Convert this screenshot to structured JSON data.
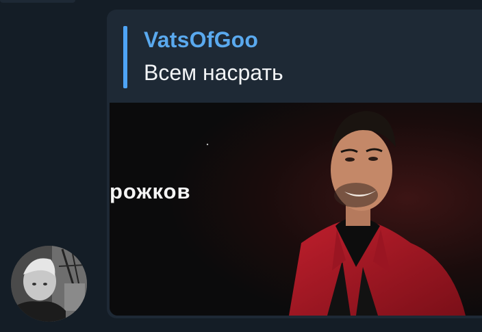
{
  "message": {
    "reply": {
      "author": "VatsOfGoo",
      "text": "Всем насрать"
    },
    "media": {
      "caption": "рожков"
    }
  },
  "colors": {
    "background": "#141d26",
    "bubble": "#1e2935",
    "accent": "#4ea4f6",
    "author": "#5aa9ee",
    "text": "#f2f4f6"
  }
}
